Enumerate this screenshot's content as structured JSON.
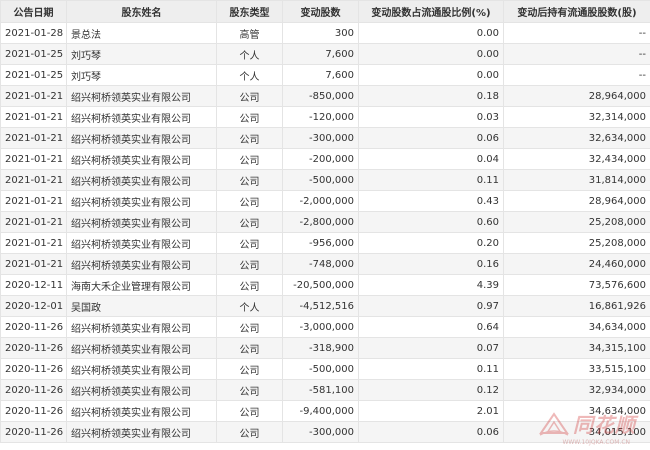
{
  "headers": [
    "公告日期",
    "股东姓名",
    "股东类型",
    "变动股数",
    "变动股数占流通股比例(%)",
    "变动后持有流通股股数(股)"
  ],
  "rows": [
    {
      "date": "2021-01-28",
      "name": "景总法",
      "type": "高管",
      "change": "300",
      "ratio": "0.00",
      "after": "--"
    },
    {
      "date": "2021-01-25",
      "name": "刘巧琴",
      "type": "个人",
      "change": "7,600",
      "ratio": "0.00",
      "after": "--"
    },
    {
      "date": "2021-01-25",
      "name": "刘巧琴",
      "type": "个人",
      "change": "7,600",
      "ratio": "0.00",
      "after": "--"
    },
    {
      "date": "2021-01-21",
      "name": "绍兴柯桥领英实业有限公司",
      "type": "公司",
      "change": "-850,000",
      "ratio": "0.18",
      "after": "28,964,000"
    },
    {
      "date": "2021-01-21",
      "name": "绍兴柯桥领英实业有限公司",
      "type": "公司",
      "change": "-120,000",
      "ratio": "0.03",
      "after": "32,314,000"
    },
    {
      "date": "2021-01-21",
      "name": "绍兴柯桥领英实业有限公司",
      "type": "公司",
      "change": "-300,000",
      "ratio": "0.06",
      "after": "32,634,000"
    },
    {
      "date": "2021-01-21",
      "name": "绍兴柯桥领英实业有限公司",
      "type": "公司",
      "change": "-200,000",
      "ratio": "0.04",
      "after": "32,434,000"
    },
    {
      "date": "2021-01-21",
      "name": "绍兴柯桥领英实业有限公司",
      "type": "公司",
      "change": "-500,000",
      "ratio": "0.11",
      "after": "31,814,000"
    },
    {
      "date": "2021-01-21",
      "name": "绍兴柯桥领英实业有限公司",
      "type": "公司",
      "change": "-2,000,000",
      "ratio": "0.43",
      "after": "28,964,000"
    },
    {
      "date": "2021-01-21",
      "name": "绍兴柯桥领英实业有限公司",
      "type": "公司",
      "change": "-2,800,000",
      "ratio": "0.60",
      "after": "25,208,000"
    },
    {
      "date": "2021-01-21",
      "name": "绍兴柯桥领英实业有限公司",
      "type": "公司",
      "change": "-956,000",
      "ratio": "0.20",
      "after": "25,208,000"
    },
    {
      "date": "2021-01-21",
      "name": "绍兴柯桥领英实业有限公司",
      "type": "公司",
      "change": "-748,000",
      "ratio": "0.16",
      "after": "24,460,000"
    },
    {
      "date": "2020-12-11",
      "name": "海南大禾企业管理有限公司",
      "type": "公司",
      "change": "-20,500,000",
      "ratio": "4.39",
      "after": "73,576,600"
    },
    {
      "date": "2020-12-01",
      "name": "吴国政",
      "type": "个人",
      "change": "-4,512,516",
      "ratio": "0.97",
      "after": "16,861,926"
    },
    {
      "date": "2020-11-26",
      "name": "绍兴柯桥领英实业有限公司",
      "type": "公司",
      "change": "-3,000,000",
      "ratio": "0.64",
      "after": "34,634,000"
    },
    {
      "date": "2020-11-26",
      "name": "绍兴柯桥领英实业有限公司",
      "type": "公司",
      "change": "-318,900",
      "ratio": "0.07",
      "after": "34,315,100"
    },
    {
      "date": "2020-11-26",
      "name": "绍兴柯桥领英实业有限公司",
      "type": "公司",
      "change": "-500,000",
      "ratio": "0.11",
      "after": "33,515,100"
    },
    {
      "date": "2020-11-26",
      "name": "绍兴柯桥领英实业有限公司",
      "type": "公司",
      "change": "-581,100",
      "ratio": "0.12",
      "after": "32,934,000"
    },
    {
      "date": "2020-11-26",
      "name": "绍兴柯桥领英实业有限公司",
      "type": "公司",
      "change": "-9,400,000",
      "ratio": "2.01",
      "after": "34,634,000"
    },
    {
      "date": "2020-11-26",
      "name": "绍兴柯桥领英实业有限公司",
      "type": "公司",
      "change": "-300,000",
      "ratio": "0.06",
      "after": "34,015,100"
    }
  ],
  "watermark": {
    "text": "同花顺",
    "sub": "WWW.10JQKA.COM.CN",
    "color": "#d23a3a"
  }
}
